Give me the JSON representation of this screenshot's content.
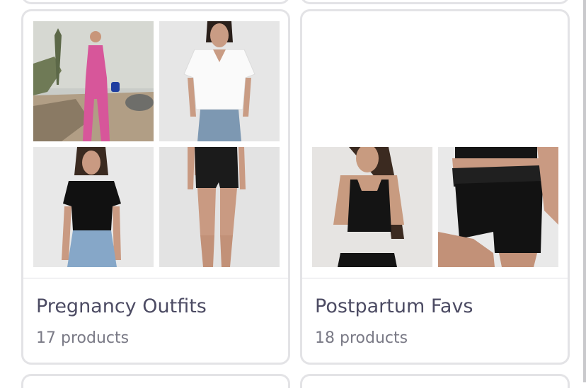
{
  "collections": [
    {
      "title": "Pregnancy Outfits",
      "count": "17 products",
      "thumbnails": [
        "beach-pink-jumpsuit",
        "white-vneck-tee-jeans",
        "black-tee-jeans",
        "black-bike-shorts"
      ]
    },
    {
      "title": "Postpartum Favs",
      "count": "18 products",
      "thumbnails": [
        "black-tank-top",
        "black-foldover-shorts"
      ]
    }
  ],
  "colors": {
    "card_border": "#e3e3e6",
    "title_text": "#4c4b63",
    "count_text": "#7a7a86"
  }
}
